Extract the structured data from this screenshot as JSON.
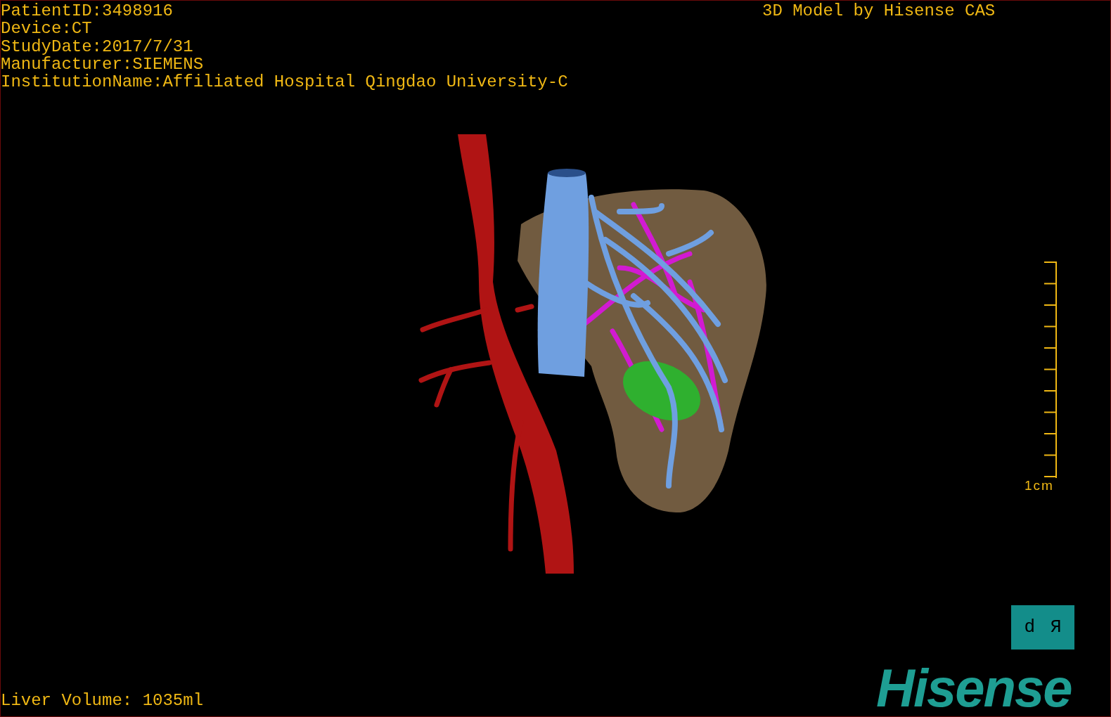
{
  "patient_info": [
    "PatientID:3498916",
    "Device:CT",
    "StudyDate:2017/7/31",
    "Manufacturer:SIEMENS",
    "InstitutionName:Affiliated Hospital Qingdao University-C"
  ],
  "caption": "3D Model by Hisense CAS",
  "scale_bar": {
    "label": "1cm"
  },
  "orientation_marker": {
    "letters": [
      "d",
      "R"
    ]
  },
  "volume": "Liver Volume: 1035ml",
  "logo": "Hisense"
}
